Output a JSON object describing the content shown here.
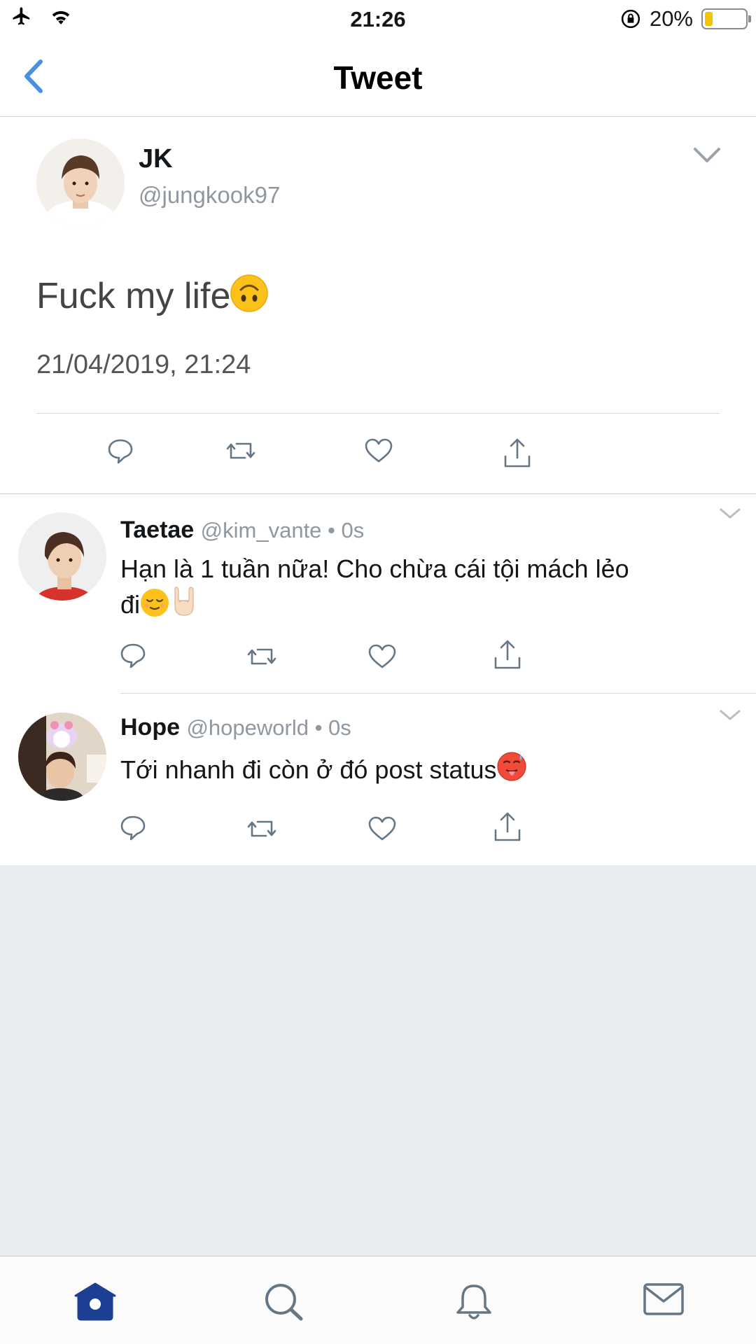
{
  "status_bar": {
    "time": "21:26",
    "battery_percent_label": "20%",
    "battery_level": 0.2,
    "icons": [
      "airplane-icon",
      "wifi-icon",
      "orientation-lock-icon",
      "battery-icon"
    ]
  },
  "nav": {
    "title": "Tweet",
    "back_icon": "chevron-left-icon"
  },
  "main_tweet": {
    "name": "JK",
    "handle": "@jungkook97",
    "text": "Fuck my life",
    "emoji": "upside-down-face",
    "date": "21/04/2019, 21:24",
    "actions": [
      "reply-icon",
      "retweet-icon",
      "like-icon",
      "share-icon"
    ]
  },
  "replies": [
    {
      "name": "Taetae",
      "handle": "@kim_vante",
      "time": " • 0s",
      "text_line1": "Hạn là 1 tuần nữa! Cho chừa cái tội mách lẻo",
      "text_line2": "đi",
      "emojis": [
        "relieved-face",
        "sign-of-horns"
      ]
    },
    {
      "name": "Hope",
      "handle": "@hopeworld",
      "time": " • 0s",
      "text_line1": "Tới nhanh đi còn ở đó post status",
      "emojis": [
        "hot-face"
      ]
    }
  ],
  "tab_bar": {
    "tabs": [
      "home-icon",
      "search-icon",
      "notifications-icon",
      "messages-icon"
    ],
    "active": "home-icon"
  },
  "colors": {
    "accent": "#1da1f2",
    "active_tab": "#1c3f94",
    "icon_gray": "#657786",
    "handle_gray": "#8f98a1",
    "empty_bg": "#e6ecf0"
  }
}
